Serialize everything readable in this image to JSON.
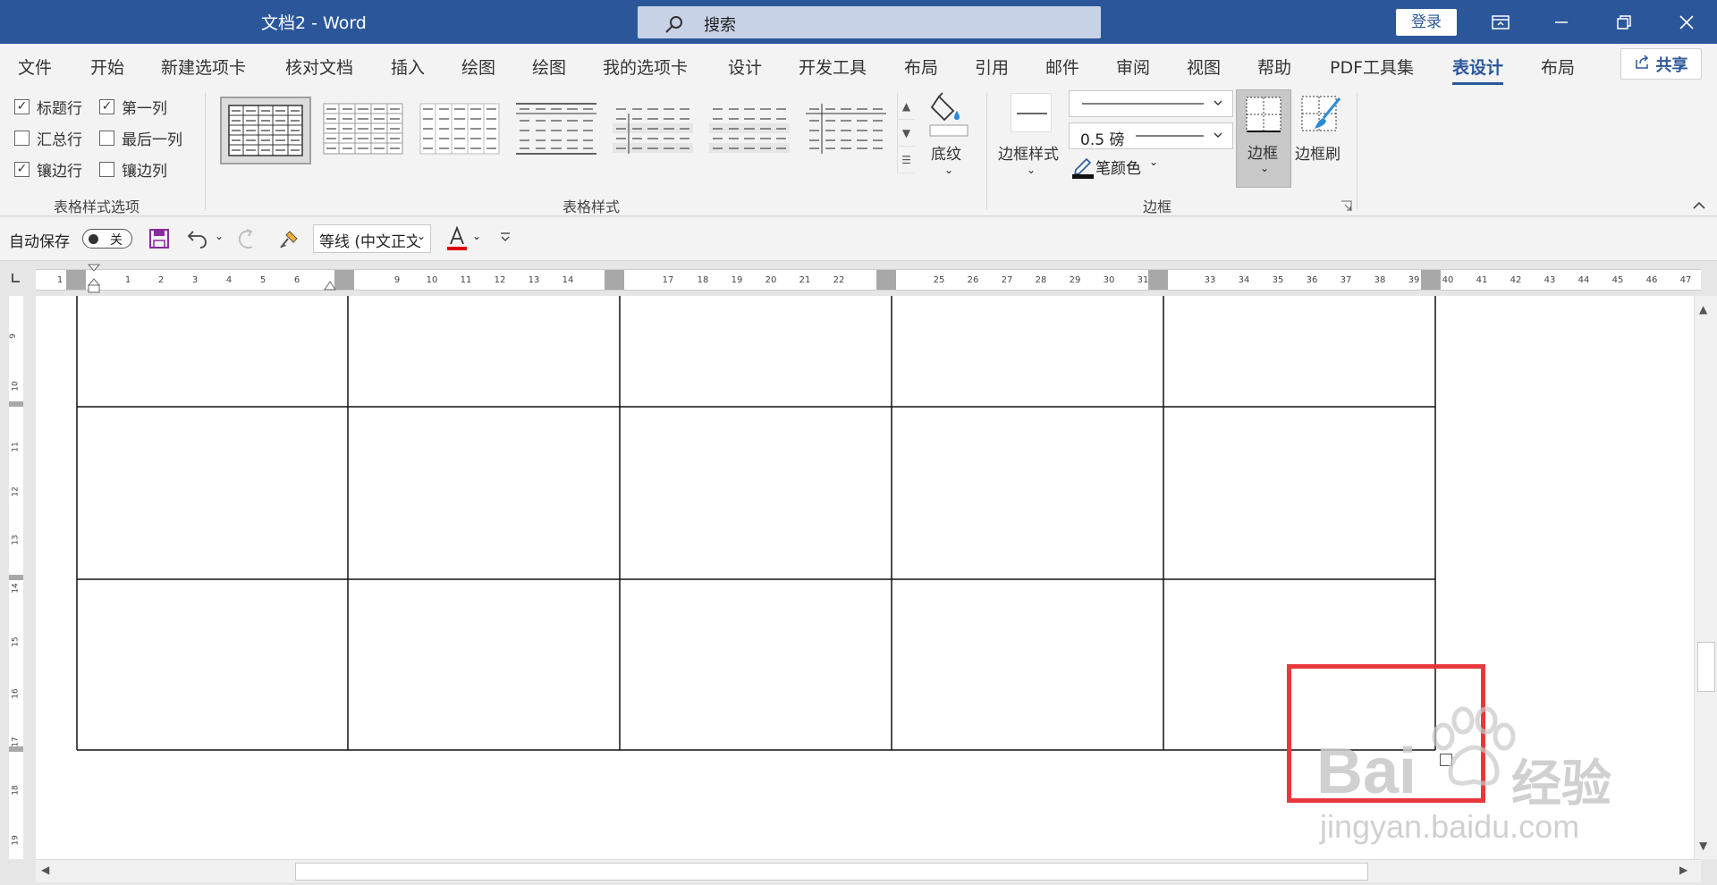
{
  "app": {
    "doc_title": "文档2  -  Word",
    "search_placeholder": "搜索",
    "login": "登录"
  },
  "tabs": [
    {
      "label": "文件",
      "active": false
    },
    {
      "label": "开始",
      "active": false
    },
    {
      "label": "新建选项卡",
      "active": false
    },
    {
      "label": "核对文档",
      "active": false
    },
    {
      "label": "插入",
      "active": false
    },
    {
      "label": "绘图",
      "active": false
    },
    {
      "label": "绘图",
      "active": false
    },
    {
      "label": "我的选项卡",
      "active": false
    },
    {
      "label": "设计",
      "active": false
    },
    {
      "label": "开发工具",
      "active": false
    },
    {
      "label": "布局",
      "active": false
    },
    {
      "label": "引用",
      "active": false
    },
    {
      "label": "邮件",
      "active": false
    },
    {
      "label": "审阅",
      "active": false
    },
    {
      "label": "视图",
      "active": false
    },
    {
      "label": "帮助",
      "active": false
    },
    {
      "label": "PDF工具集",
      "active": false
    },
    {
      "label": "表设计",
      "active": true
    },
    {
      "label": "布局",
      "active": false
    }
  ],
  "share": "共享",
  "style_options": {
    "items": [
      {
        "label": "标题行",
        "checked": true
      },
      {
        "label": "第一列",
        "checked": true
      },
      {
        "label": "汇总行",
        "checked": false
      },
      {
        "label": "最后一列",
        "checked": false
      },
      {
        "label": "镶边行",
        "checked": true
      },
      {
        "label": "镶边列",
        "checked": false
      }
    ],
    "group_label": "表格样式选项"
  },
  "table_styles": {
    "group_label": "表格样式",
    "shading_label": "底纹"
  },
  "borders": {
    "group_label": "边框",
    "border_styles_label": "边框样式",
    "weight_label": "0.5 磅",
    "pen_color_label": "笔颜色",
    "borders_label": "边框",
    "border_painter_label": "边框刷"
  },
  "qat": {
    "autosave_label": "自动保存",
    "toggle_state": "关",
    "font_name": "等线 (中文正文"
  },
  "ruler_numbers": [
    "1",
    "1",
    "2",
    "3",
    "4",
    "5",
    "6",
    "9",
    "10",
    "11",
    "12",
    "13",
    "14",
    "17",
    "18",
    "19",
    "20",
    "21",
    "22",
    "25",
    "26",
    "27",
    "28",
    "29",
    "30",
    "31",
    "33",
    "34",
    "35",
    "36",
    "37",
    "38",
    "39",
    "40",
    "41",
    "42",
    "43",
    "44",
    "45",
    "46",
    "47"
  ],
  "vruler_numbers": [
    "9",
    "10",
    "11",
    "12",
    "13",
    "14",
    "15",
    "16",
    "17",
    "18",
    "19"
  ],
  "watermark": {
    "brand": "Bai",
    "brand_cn": "经验",
    "url": "jingyan.baidu.com"
  }
}
